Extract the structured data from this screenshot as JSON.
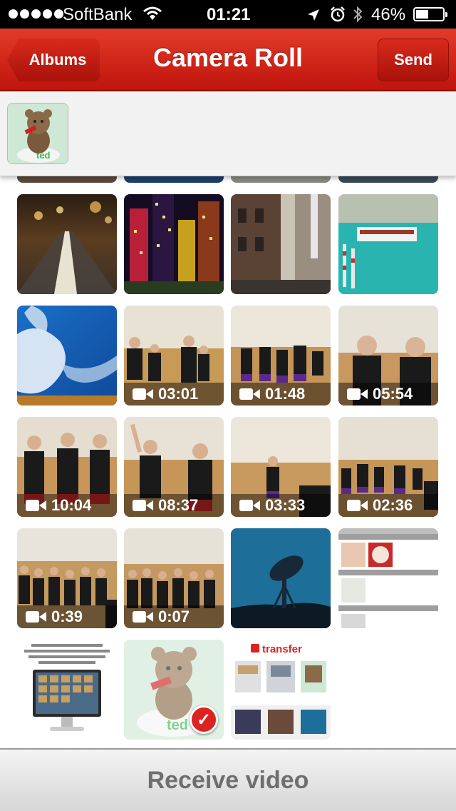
{
  "status": {
    "carrier": "SoftBank",
    "time": "01:21",
    "battery_pct": "46%",
    "battery_level": 0.46
  },
  "nav": {
    "back_label": "Albums",
    "title": "Camera Roll",
    "send_label": "Send"
  },
  "grid": {
    "tiles": [
      {
        "kind": "photo",
        "subject": "road"
      },
      {
        "kind": "photo",
        "subject": "city-night"
      },
      {
        "kind": "photo",
        "subject": "alley"
      },
      {
        "kind": "photo",
        "subject": "boat"
      },
      {
        "kind": "photo",
        "subject": "sky"
      },
      {
        "kind": "video",
        "duration": "03:01"
      },
      {
        "kind": "video",
        "duration": "01:48"
      },
      {
        "kind": "video",
        "duration": "05:54"
      },
      {
        "kind": "video",
        "duration": "10:04"
      },
      {
        "kind": "video",
        "duration": "08:37"
      },
      {
        "kind": "video",
        "duration": "03:33"
      },
      {
        "kind": "video",
        "duration": "02:36"
      },
      {
        "kind": "video",
        "duration": "0:39"
      },
      {
        "kind": "video",
        "duration": "0:07"
      },
      {
        "kind": "photo",
        "subject": "antenna"
      },
      {
        "kind": "screenshot",
        "subject": "calendar-screenshot"
      },
      {
        "kind": "screenshot",
        "subject": "itransfer-screenshot"
      },
      {
        "kind": "photo",
        "subject": "ted-figure",
        "selected": true
      },
      {
        "kind": "screenshot",
        "subject": "transfer-app-screenshot"
      }
    ]
  },
  "bottom": {
    "label": "Receive video"
  }
}
